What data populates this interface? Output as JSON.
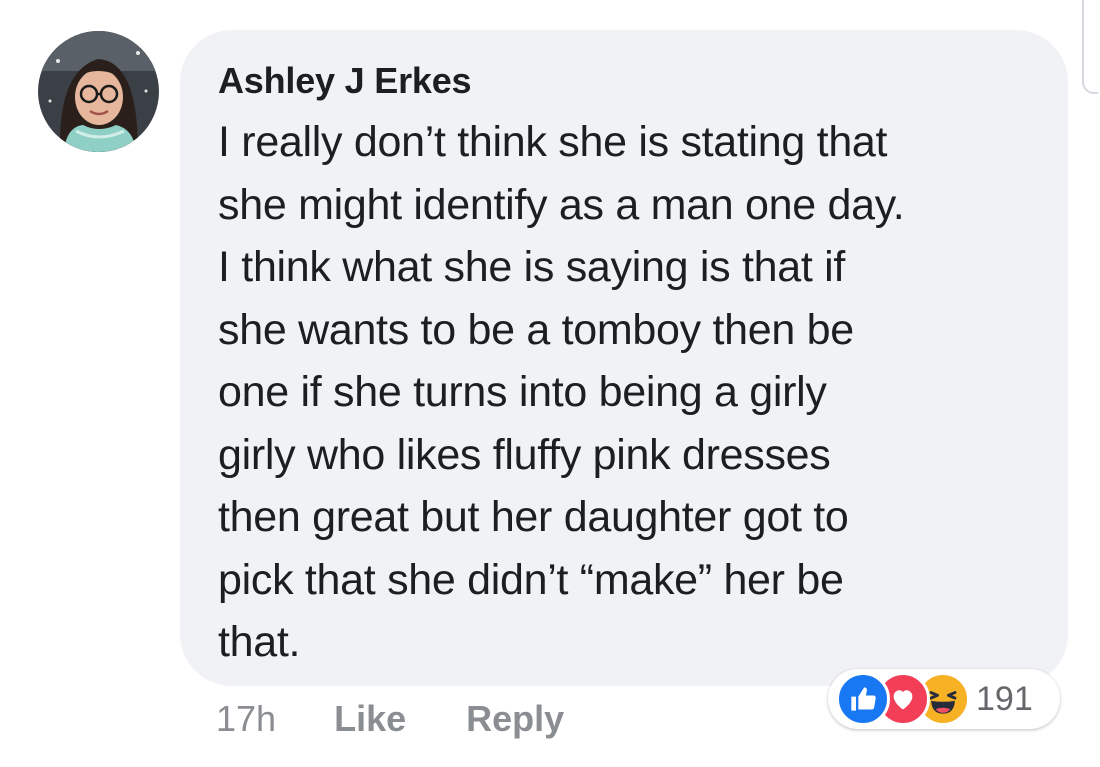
{
  "comment": {
    "author": "Ashley J Erkes",
    "text": "I really don’t think she is stating that\nshe might identify as a man one day.\nI think what she is saying is that if\nshe wants to be a tomboy then be\none if  she turns into being a girly\ngirly who likes fluffy pink dresses\nthen great but her daughter got to\npick that she didn’t “make” her be\nthat."
  },
  "actions": {
    "timestamp": "17h",
    "like_label": "Like",
    "reply_label": "Reply"
  },
  "reactions": {
    "icons": [
      "like-icon",
      "love-icon",
      "haha-icon"
    ],
    "count": "191"
  },
  "colors": {
    "bubble": "#f1f2f6",
    "text": "#1c1e21",
    "muted": "#8a8d91",
    "like": "#1877f2",
    "love": "#f33e58",
    "haha": "#f7b125"
  }
}
